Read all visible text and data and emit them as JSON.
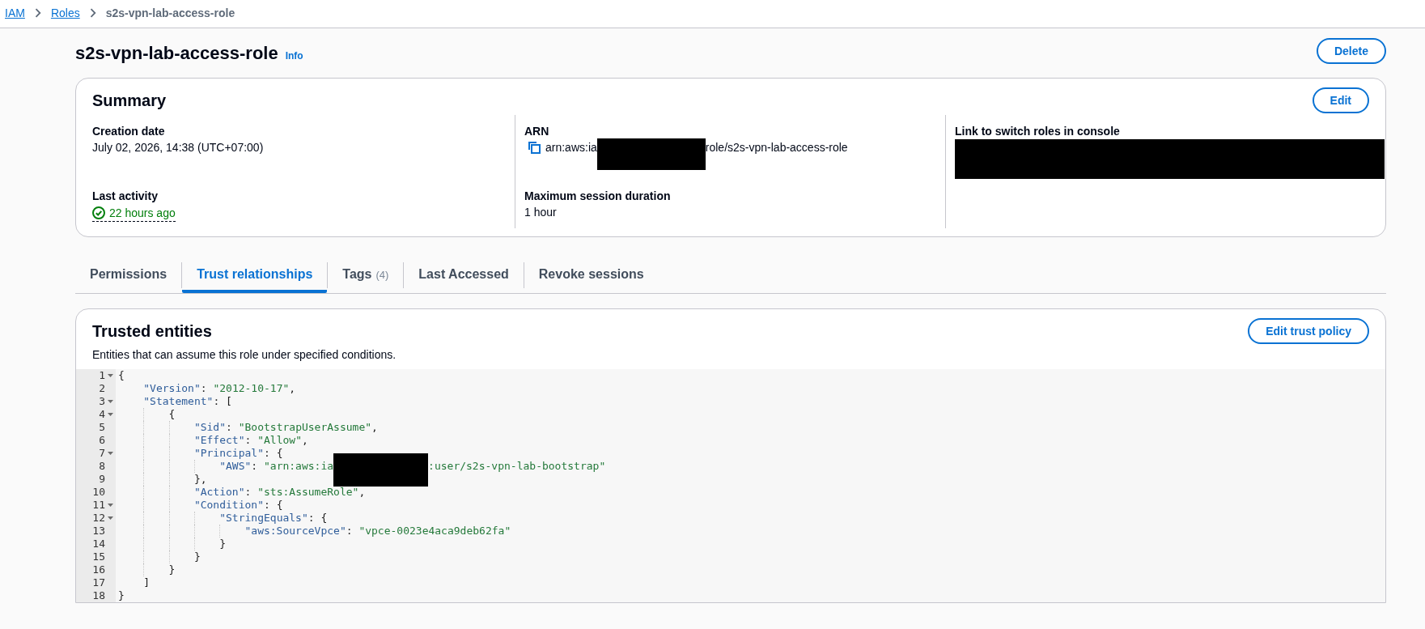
{
  "breadcrumbs": [
    {
      "kind": "link",
      "label": "IAM"
    },
    {
      "kind": "link",
      "label": "Roles"
    },
    {
      "kind": "current",
      "label": "s2s-vpn-lab-access-role"
    }
  ],
  "page_header": {
    "title": "s2s-vpn-lab-access-role",
    "info_link": "Info",
    "buttons": [
      "Delete"
    ]
  },
  "summary": {
    "title": "Summary",
    "buttons": [
      "Edit"
    ],
    "columns": [
      {
        "fields": [
          {
            "label": "Creation date",
            "kind": "plain",
            "parts": [
              {
                "kind": "text",
                "text": "July 02, 2026, 14:38 (UTC+07:00)"
              }
            ]
          },
          {
            "label": "Last activity",
            "kind": "status",
            "parts": [
              {
                "kind": "text",
                "text": "22 hours ago"
              }
            ]
          }
        ]
      },
      {
        "fields": [
          {
            "label": "ARN",
            "kind": "copyable",
            "parts": [
              {
                "kind": "text",
                "text": "arn:aws:ia"
              },
              {
                "kind": "redacted"
              },
              {
                "kind": "text",
                "text": "role/s2s-vpn-lab-access-role"
              }
            ]
          },
          {
            "label": "Maximum session duration",
            "kind": "plain",
            "parts": [
              {
                "kind": "text",
                "text": "1 hour"
              }
            ]
          }
        ]
      },
      {
        "fields": [
          {
            "label": "Link to switch roles in console",
            "kind": "plain",
            "parts": [
              {
                "kind": "redacted"
              }
            ]
          }
        ]
      }
    ]
  },
  "tabs": [
    {
      "label": "Permissions",
      "selected": false
    },
    {
      "label": "Trust relationships",
      "selected": true
    },
    {
      "label": "Tags",
      "count": "(4)",
      "selected": false
    },
    {
      "label": "Last Accessed",
      "selected": false
    },
    {
      "label": "Revoke sessions",
      "selected": false
    }
  ],
  "trusted_entities": {
    "title": "Trusted entities",
    "description": "Entities that can assume this role under specified conditions.",
    "buttons": [
      "Edit trust policy"
    ],
    "policy_editor": {
      "lines": [
        {
          "number": "1",
          "foldable": true,
          "tokens": [
            {
              "kind": "punct",
              "text": "{"
            }
          ]
        },
        {
          "number": "2",
          "foldable": false,
          "tokens": [
            {
              "kind": "key",
              "text": "    \"Version\""
            },
            {
              "kind": "punct",
              "text": ": "
            },
            {
              "kind": "string",
              "text": "\"2012-10-17\""
            },
            {
              "kind": "punct",
              "text": ","
            }
          ]
        },
        {
          "number": "3",
          "foldable": true,
          "tokens": [
            {
              "kind": "key",
              "text": "    \"Statement\""
            },
            {
              "kind": "punct",
              "text": ": ["
            }
          ]
        },
        {
          "number": "4",
          "foldable": true,
          "tokens": [
            {
              "kind": "punct",
              "text": "        {"
            }
          ]
        },
        {
          "number": "5",
          "foldable": false,
          "tokens": [
            {
              "kind": "key",
              "text": "            \"Sid\""
            },
            {
              "kind": "punct",
              "text": ": "
            },
            {
              "kind": "string",
              "text": "\"BootstrapUserAssume\""
            },
            {
              "kind": "punct",
              "text": ","
            }
          ]
        },
        {
          "number": "6",
          "foldable": false,
          "tokens": [
            {
              "kind": "key",
              "text": "            \"Effect\""
            },
            {
              "kind": "punct",
              "text": ": "
            },
            {
              "kind": "string",
              "text": "\"Allow\""
            },
            {
              "kind": "punct",
              "text": ","
            }
          ]
        },
        {
          "number": "7",
          "foldable": true,
          "tokens": [
            {
              "kind": "key",
              "text": "            \"Principal\""
            },
            {
              "kind": "punct",
              "text": ": {"
            }
          ]
        },
        {
          "number": "8",
          "foldable": false,
          "tokens": [
            {
              "kind": "key",
              "text": "                \"AWS\""
            },
            {
              "kind": "punct",
              "text": ": "
            },
            {
              "kind": "string",
              "text": "\"arn:aws:ia"
            },
            {
              "kind": "redacted"
            },
            {
              "kind": "string",
              "text": ":user/s2s-vpn-lab-bootstrap\""
            }
          ]
        },
        {
          "number": "9",
          "foldable": false,
          "tokens": [
            {
              "kind": "punct",
              "text": "            },"
            }
          ]
        },
        {
          "number": "10",
          "foldable": false,
          "tokens": [
            {
              "kind": "key",
              "text": "            \"Action\""
            },
            {
              "kind": "punct",
              "text": ": "
            },
            {
              "kind": "string",
              "text": "\"sts:AssumeRole\""
            },
            {
              "kind": "punct",
              "text": ","
            }
          ]
        },
        {
          "number": "11",
          "foldable": true,
          "tokens": [
            {
              "kind": "key",
              "text": "            \"Condition\""
            },
            {
              "kind": "punct",
              "text": ": {"
            }
          ]
        },
        {
          "number": "12",
          "foldable": true,
          "tokens": [
            {
              "kind": "key",
              "text": "                \"StringEquals\""
            },
            {
              "kind": "punct",
              "text": ": {"
            }
          ]
        },
        {
          "number": "13",
          "foldable": false,
          "tokens": [
            {
              "kind": "key",
              "text": "                    \"aws:SourceVpce\""
            },
            {
              "kind": "punct",
              "text": ": "
            },
            {
              "kind": "string",
              "text": "\"vpce-0023e4aca9deb62fa\""
            }
          ]
        },
        {
          "number": "14",
          "foldable": false,
          "tokens": [
            {
              "kind": "punct",
              "text": "                }"
            }
          ]
        },
        {
          "number": "15",
          "foldable": false,
          "tokens": [
            {
              "kind": "punct",
              "text": "            }"
            }
          ]
        },
        {
          "number": "16",
          "foldable": false,
          "tokens": [
            {
              "kind": "punct",
              "text": "        }"
            }
          ]
        },
        {
          "number": "17",
          "foldable": false,
          "tokens": [
            {
              "kind": "punct",
              "text": "    ]"
            }
          ]
        },
        {
          "number": "18",
          "foldable": false,
          "tokens": [
            {
              "kind": "punct",
              "text": "}"
            }
          ]
        }
      ]
    }
  }
}
